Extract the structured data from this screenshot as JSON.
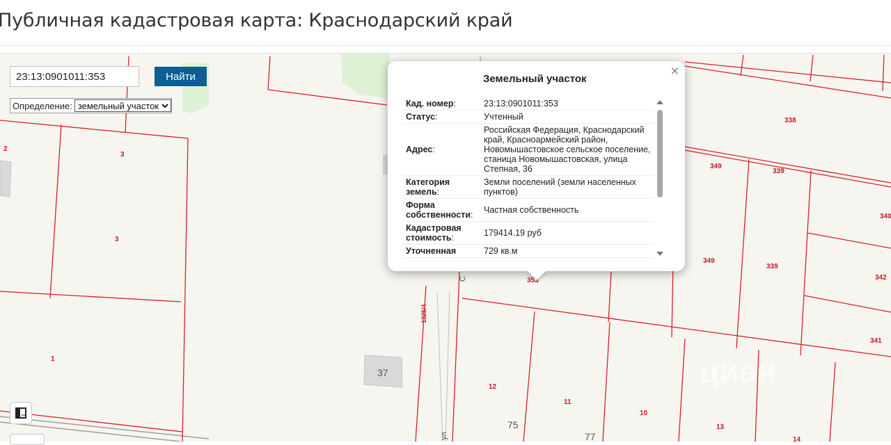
{
  "page": {
    "title": "Публичная кадастровая карта: Краснодарский край"
  },
  "search": {
    "value": "23:13:0901011:353",
    "button_label": "Найти"
  },
  "definition": {
    "label": "Определение:",
    "selected": "земельный участок"
  },
  "map": {
    "parcel_labels": [
      "2",
      "3",
      "3",
      "1",
      "338",
      "349",
      "339",
      "340",
      "349",
      "339",
      "342",
      "341",
      "12",
      "11",
      "10",
      "13",
      "14",
      "353",
      "1325/4"
    ],
    "house_numbers": [
      "37",
      "75",
      "77"
    ],
    "street_labels": [
      "ул",
      "С"
    ],
    "watermark": "циан"
  },
  "popup": {
    "title": "Земельный участок",
    "close": "×",
    "rows": [
      {
        "key": "Кад. номер",
        "value": "23:13:0901011:353"
      },
      {
        "key": "Статус",
        "value": "Учтенный"
      },
      {
        "key": "Адрес",
        "value": "Российская Федерация, Краснодарский край, Красноармейский район, Новомышастовское сельское поселение, станица Новомышастовская, улица Степная, 36"
      },
      {
        "key": "Категория земель",
        "value": "Земли поселений (земли населенных пунктов)"
      },
      {
        "key": "Форма собственности",
        "value": "Частная собственность"
      },
      {
        "key": "Кадастровая стоимость",
        "value": "179414.19 руб"
      },
      {
        "key": "Уточненная",
        "value": "729 кв.м"
      }
    ]
  },
  "colors": {
    "parcel_border": "#d8212e",
    "label": "#c51c28",
    "button": "#0c5e93",
    "park": "#dff1d4",
    "map_bg": "#f6f5f0"
  }
}
